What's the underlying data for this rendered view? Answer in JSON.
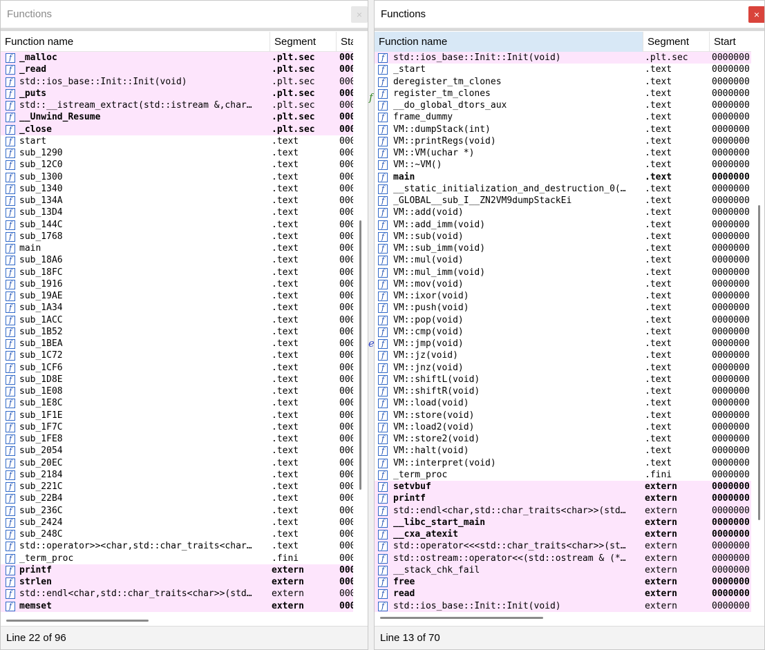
{
  "left": {
    "title": "Functions",
    "close": "×",
    "columns": {
      "name": "Function name",
      "segment": "Segment",
      "start": "Sta"
    },
    "status": "Line 22 of 96",
    "rows": [
      {
        "n": "_malloc",
        "s": ".plt.sec",
        "a": "000",
        "h": true,
        "b": true
      },
      {
        "n": "_read",
        "s": ".plt.sec",
        "a": "000",
        "h": true,
        "b": true
      },
      {
        "n": "std::ios_base::Init::Init(void)",
        "s": ".plt.sec",
        "a": "000",
        "h": true,
        "b": false
      },
      {
        "n": "_puts",
        "s": ".plt.sec",
        "a": "000",
        "h": true,
        "b": true
      },
      {
        "n": "std::__istream_extract(std::istream &,char…",
        "s": ".plt.sec",
        "a": "000",
        "h": true,
        "b": false
      },
      {
        "n": "__Unwind_Resume",
        "s": ".plt.sec",
        "a": "000",
        "h": true,
        "b": true
      },
      {
        "n": "_close",
        "s": ".plt.sec",
        "a": "000",
        "h": true,
        "b": true
      },
      {
        "n": "start",
        "s": ".text",
        "a": "000"
      },
      {
        "n": "sub_1290",
        "s": ".text",
        "a": "000"
      },
      {
        "n": "sub_12C0",
        "s": ".text",
        "a": "000"
      },
      {
        "n": "sub_1300",
        "s": ".text",
        "a": "000"
      },
      {
        "n": "sub_1340",
        "s": ".text",
        "a": "000"
      },
      {
        "n": "sub_134A",
        "s": ".text",
        "a": "000"
      },
      {
        "n": "sub_13D4",
        "s": ".text",
        "a": "000"
      },
      {
        "n": "sub_144C",
        "s": ".text",
        "a": "000"
      },
      {
        "n": "sub_1768",
        "s": ".text",
        "a": "000"
      },
      {
        "n": "main",
        "s": ".text",
        "a": "000"
      },
      {
        "n": "sub_18A6",
        "s": ".text",
        "a": "000"
      },
      {
        "n": "sub_18FC",
        "s": ".text",
        "a": "000"
      },
      {
        "n": "sub_1916",
        "s": ".text",
        "a": "000"
      },
      {
        "n": "sub_19AE",
        "s": ".text",
        "a": "000"
      },
      {
        "n": "sub_1A34",
        "s": ".text",
        "a": "000"
      },
      {
        "n": "sub_1ACC",
        "s": ".text",
        "a": "000"
      },
      {
        "n": "sub_1B52",
        "s": ".text",
        "a": "000"
      },
      {
        "n": "sub_1BEA",
        "s": ".text",
        "a": "000"
      },
      {
        "n": "sub_1C72",
        "s": ".text",
        "a": "000"
      },
      {
        "n": "sub_1CF6",
        "s": ".text",
        "a": "000"
      },
      {
        "n": "sub_1D8E",
        "s": ".text",
        "a": "000"
      },
      {
        "n": "sub_1E08",
        "s": ".text",
        "a": "000"
      },
      {
        "n": "sub_1E8C",
        "s": ".text",
        "a": "000"
      },
      {
        "n": "sub_1F1E",
        "s": ".text",
        "a": "000"
      },
      {
        "n": "sub_1F7C",
        "s": ".text",
        "a": "000"
      },
      {
        "n": "sub_1FE8",
        "s": ".text",
        "a": "000"
      },
      {
        "n": "sub_2054",
        "s": ".text",
        "a": "000"
      },
      {
        "n": "sub_20EC",
        "s": ".text",
        "a": "000"
      },
      {
        "n": "sub_2184",
        "s": ".text",
        "a": "000"
      },
      {
        "n": "sub_221C",
        "s": ".text",
        "a": "000"
      },
      {
        "n": "sub_22B4",
        "s": ".text",
        "a": "000"
      },
      {
        "n": "sub_236C",
        "s": ".text",
        "a": "000"
      },
      {
        "n": "sub_2424",
        "s": ".text",
        "a": "000"
      },
      {
        "n": "sub_248C",
        "s": ".text",
        "a": "000"
      },
      {
        "n": "std::operator>><char,std::char_traits<char…",
        "s": ".text",
        "a": "000"
      },
      {
        "n": "_term_proc",
        "s": ".fini",
        "a": "000"
      },
      {
        "n": "printf",
        "s": "extern",
        "a": "000",
        "h": true,
        "b": true
      },
      {
        "n": "strlen",
        "s": "extern",
        "a": "000",
        "h": true,
        "b": true
      },
      {
        "n": "std::endl<char,std::char_traits<char>>(std…",
        "s": "extern",
        "a": "000",
        "h": true,
        "b": false
      },
      {
        "n": "memset",
        "s": "extern",
        "a": "000",
        "h": true,
        "b": true
      }
    ]
  },
  "right": {
    "title": "Functions",
    "close": "×",
    "columns": {
      "name": "Function name",
      "segment": "Segment",
      "start": "Start"
    },
    "status": "Line 13 of 70",
    "rows": [
      {
        "n": "std::ios_base::Init::Init(void)",
        "s": ".plt.sec",
        "a": "0000000",
        "h": true,
        "b": false
      },
      {
        "n": "_start",
        "s": ".text",
        "a": "0000000"
      },
      {
        "n": "deregister_tm_clones",
        "s": ".text",
        "a": "0000000"
      },
      {
        "n": "register_tm_clones",
        "s": ".text",
        "a": "0000000"
      },
      {
        "n": "__do_global_dtors_aux",
        "s": ".text",
        "a": "0000000"
      },
      {
        "n": "frame_dummy",
        "s": ".text",
        "a": "0000000"
      },
      {
        "n": "VM::dumpStack(int)",
        "s": ".text",
        "a": "0000000"
      },
      {
        "n": "VM::printRegs(void)",
        "s": ".text",
        "a": "0000000"
      },
      {
        "n": "VM::VM(uchar *)",
        "s": ".text",
        "a": "0000000"
      },
      {
        "n": "VM::~VM()",
        "s": ".text",
        "a": "0000000"
      },
      {
        "n": "main",
        "s": ".text",
        "a": "0000000",
        "b": true
      },
      {
        "n": "__static_initialization_and_destruction_0(…",
        "s": ".text",
        "a": "0000000"
      },
      {
        "n": "_GLOBAL__sub_I__ZN2VM9dumpStackEi",
        "s": ".text",
        "a": "0000000"
      },
      {
        "n": "VM::add(void)",
        "s": ".text",
        "a": "0000000"
      },
      {
        "n": "VM::add_imm(void)",
        "s": ".text",
        "a": "0000000"
      },
      {
        "n": "VM::sub(void)",
        "s": ".text",
        "a": "0000000"
      },
      {
        "n": "VM::sub_imm(void)",
        "s": ".text",
        "a": "0000000"
      },
      {
        "n": "VM::mul(void)",
        "s": ".text",
        "a": "0000000"
      },
      {
        "n": "VM::mul_imm(void)",
        "s": ".text",
        "a": "0000000"
      },
      {
        "n": "VM::mov(void)",
        "s": ".text",
        "a": "0000000"
      },
      {
        "n": "VM::ixor(void)",
        "s": ".text",
        "a": "0000000"
      },
      {
        "n": "VM::push(void)",
        "s": ".text",
        "a": "0000000"
      },
      {
        "n": "VM::pop(void)",
        "s": ".text",
        "a": "0000000"
      },
      {
        "n": "VM::cmp(void)",
        "s": ".text",
        "a": "0000000"
      },
      {
        "n": "VM::jmp(void)",
        "s": ".text",
        "a": "0000000"
      },
      {
        "n": "VM::jz(void)",
        "s": ".text",
        "a": "0000000"
      },
      {
        "n": "VM::jnz(void)",
        "s": ".text",
        "a": "0000000"
      },
      {
        "n": "VM::shiftL(void)",
        "s": ".text",
        "a": "0000000"
      },
      {
        "n": "VM::shiftR(void)",
        "s": ".text",
        "a": "0000000"
      },
      {
        "n": "VM::load(void)",
        "s": ".text",
        "a": "0000000"
      },
      {
        "n": "VM::store(void)",
        "s": ".text",
        "a": "0000000"
      },
      {
        "n": "VM::load2(void)",
        "s": ".text",
        "a": "0000000"
      },
      {
        "n": "VM::store2(void)",
        "s": ".text",
        "a": "0000000"
      },
      {
        "n": "VM::halt(void)",
        "s": ".text",
        "a": "0000000"
      },
      {
        "n": "VM::interpret(void)",
        "s": ".text",
        "a": "0000000"
      },
      {
        "n": "_term_proc",
        "s": ".fini",
        "a": "0000000"
      },
      {
        "n": "setvbuf",
        "s": "extern",
        "a": "0000000",
        "h": true,
        "b": true
      },
      {
        "n": "printf",
        "s": "extern",
        "a": "0000000",
        "h": true,
        "b": true
      },
      {
        "n": "std::endl<char,std::char_traits<char>>(std…",
        "s": "extern",
        "a": "0000000",
        "h": true,
        "b": false
      },
      {
        "n": "__libc_start_main",
        "s": "extern",
        "a": "0000000",
        "h": true,
        "b": true
      },
      {
        "n": "__cxa_atexit",
        "s": "extern",
        "a": "0000000",
        "h": true,
        "b": true
      },
      {
        "n": "std::operator<<<std::char_traits<char>>(st…",
        "s": "extern",
        "a": "0000000",
        "h": true,
        "b": false
      },
      {
        "n": "std::ostream::operator<<(std::ostream & (*…",
        "s": "extern",
        "a": "0000000",
        "h": true,
        "b": false
      },
      {
        "n": "__stack_chk_fail",
        "s": "extern",
        "a": "0000000",
        "h": true,
        "b": false
      },
      {
        "n": "free",
        "s": "extern",
        "a": "0000000",
        "h": true,
        "b": true
      },
      {
        "n": "read",
        "s": "extern",
        "a": "0000000",
        "h": true,
        "b": true
      },
      {
        "n": "std::ios_base::Init::Init(void)",
        "s": "extern",
        "a": "0000000",
        "h": true,
        "b": false
      }
    ]
  },
  "background_glyphs": [
    "f",
    "e"
  ],
  "colors": {
    "highlight_row": "#fde5fc",
    "icon_blue": "#2f68c8",
    "close_red": "#d9433b"
  }
}
